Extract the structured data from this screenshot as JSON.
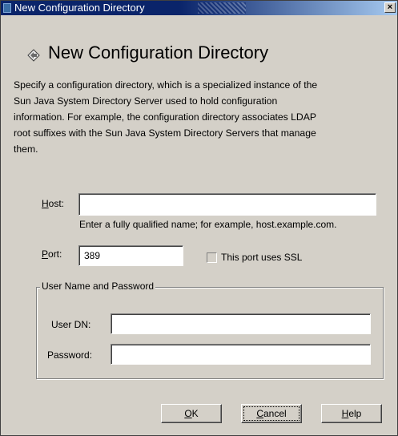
{
  "window": {
    "title": "New Configuration Directory",
    "close_glyph": "×"
  },
  "header": {
    "title": "New Configuration Directory",
    "icon": "diamond-arrow-icon"
  },
  "description": [
    "Specify a configuration directory, which is a specialized instance of the",
    "Sun Java System Directory Server used to hold configuration",
    "information. For example, the configuration directory associates LDAP",
    "root suffixes with the Sun Java System Directory Servers that manage",
    "them."
  ],
  "host": {
    "label_mnemonic": "H",
    "label_rest": "ost:",
    "value": "",
    "hint": "Enter a fully qualified name; for example, host.example.com."
  },
  "port": {
    "label_mnemonic": "P",
    "label_rest": "ort:",
    "value": "389",
    "ssl_label": "This port uses SSL",
    "ssl_checked": false
  },
  "credentials": {
    "group_label": "User Name and Password",
    "user_dn_label": "User DN:",
    "user_dn_value": "",
    "password_label": "Password:",
    "password_value": ""
  },
  "buttons": {
    "ok_mnemonic": "O",
    "ok_rest": "K",
    "cancel_mnemonic": "C",
    "cancel_rest": "ancel",
    "help_mnemonic": "H",
    "help_rest": "elp"
  },
  "colors": {
    "title_bar": "#0a246a",
    "dialog_bg": "#d4d0c8"
  }
}
